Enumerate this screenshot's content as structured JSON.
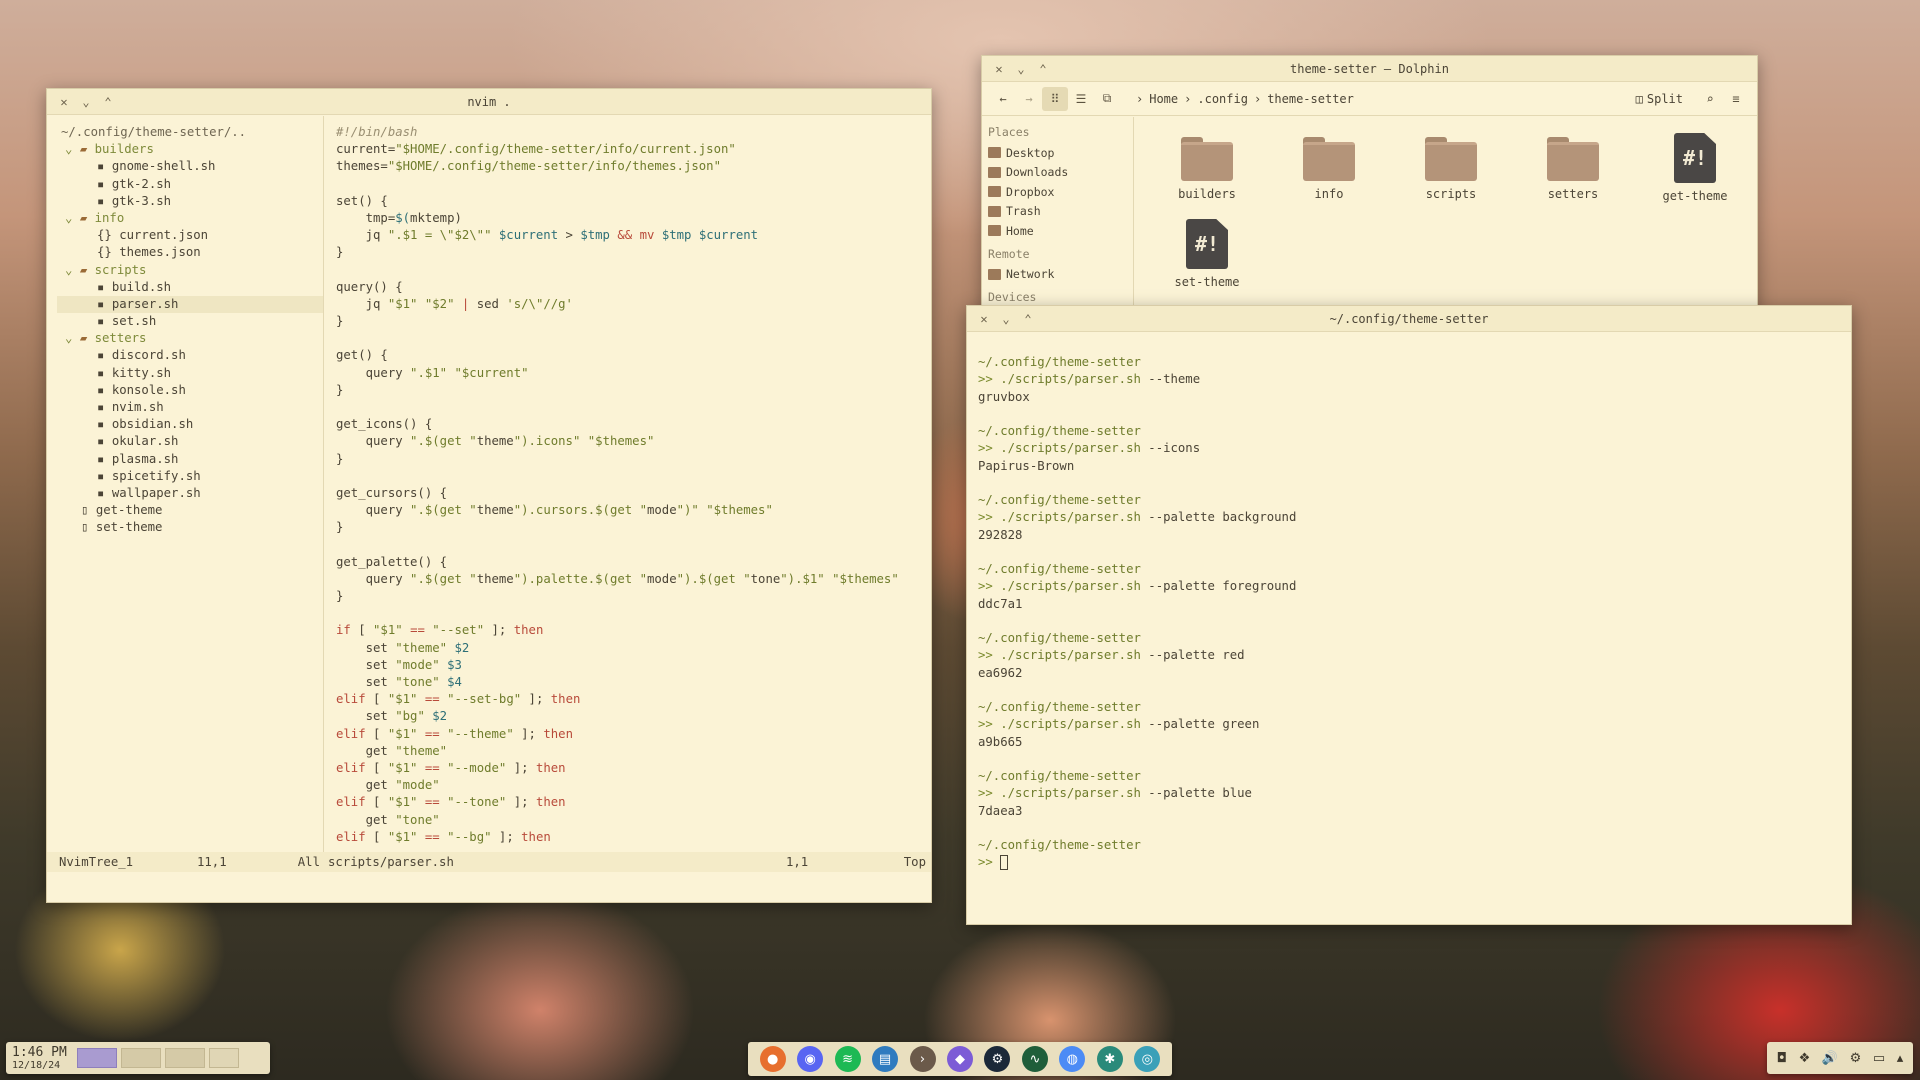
{
  "nvim": {
    "title": "nvim .",
    "tree": [
      {
        "t": "~/.config/theme-setter/..",
        "d": 0,
        "k": "root"
      },
      {
        "t": "builders",
        "d": 1,
        "k": "dir"
      },
      {
        "t": "gnome-shell.sh",
        "d": 2,
        "k": "sh"
      },
      {
        "t": "gtk-2.sh",
        "d": 2,
        "k": "sh"
      },
      {
        "t": "gtk-3.sh",
        "d": 2,
        "k": "sh"
      },
      {
        "t": "info",
        "d": 1,
        "k": "dir"
      },
      {
        "t": "current.json",
        "d": 2,
        "k": "json"
      },
      {
        "t": "themes.json",
        "d": 2,
        "k": "json"
      },
      {
        "t": "scripts",
        "d": 1,
        "k": "dir"
      },
      {
        "t": "build.sh",
        "d": 2,
        "k": "sh"
      },
      {
        "t": "parser.sh",
        "d": 2,
        "k": "sh",
        "sel": true
      },
      {
        "t": "set.sh",
        "d": 2,
        "k": "sh"
      },
      {
        "t": "setters",
        "d": 1,
        "k": "dir"
      },
      {
        "t": "discord.sh",
        "d": 2,
        "k": "sh"
      },
      {
        "t": "kitty.sh",
        "d": 2,
        "k": "sh"
      },
      {
        "t": "konsole.sh",
        "d": 2,
        "k": "sh"
      },
      {
        "t": "nvim.sh",
        "d": 2,
        "k": "sh"
      },
      {
        "t": "obsidian.sh",
        "d": 2,
        "k": "sh"
      },
      {
        "t": "okular.sh",
        "d": 2,
        "k": "sh"
      },
      {
        "t": "plasma.sh",
        "d": 2,
        "k": "sh"
      },
      {
        "t": "spicetify.sh",
        "d": 2,
        "k": "sh"
      },
      {
        "t": "wallpaper.sh",
        "d": 2,
        "k": "sh"
      },
      {
        "t": "get-theme",
        "d": 1,
        "k": "file"
      },
      {
        "t": "set-theme",
        "d": 1,
        "k": "file"
      }
    ],
    "code": [
      "#!/bin/bash",
      "current=\"$HOME/.config/theme-setter/info/current.json\"",
      "themes=\"$HOME/.config/theme-setter/info/themes.json\"",
      "",
      "set() {",
      "    tmp=$(mktemp)",
      "    jq \".$1 = \\\"$2\\\"\" $current > $tmp && mv $tmp $current",
      "}",
      "",
      "query() {",
      "    jq \"$1\" \"$2\" | sed 's/\\\"//g'",
      "}",
      "",
      "get() {",
      "    query \".$1\" \"$current\"",
      "}",
      "",
      "get_icons() {",
      "    query \".$(get \"theme\").icons\" \"$themes\"",
      "}",
      "",
      "get_cursors() {",
      "    query \".$(get \"theme\").cursors.$(get \"mode\")\" \"$themes\"",
      "}",
      "",
      "get_palette() {",
      "    query \".$(get \"theme\").palette.$(get \"mode\").$(get \"tone\").$1\" \"$themes\"",
      "}",
      "",
      "if [ \"$1\" == \"--set\" ]; then",
      "    set \"theme\" $2",
      "    set \"mode\" $3",
      "    set \"tone\" $4",
      "elif [ \"$1\" == \"--set-bg\" ]; then",
      "    set \"bg\" $2",
      "elif [ \"$1\" == \"--theme\" ]; then",
      "    get \"theme\"",
      "elif [ \"$1\" == \"--mode\" ]; then",
      "    get \"mode\"",
      "elif [ \"$1\" == \"--tone\" ]; then",
      "    get \"tone\"",
      "elif [ \"$1\" == \"--bg\" ]; then"
    ],
    "status": {
      "tree_name": "NvimTree_1",
      "tree_pos": "11,1",
      "tree_pct": "All",
      "file": "scripts/parser.sh",
      "pos": "1,1",
      "pct": "Top"
    }
  },
  "dolphin": {
    "title": "theme-setter — Dolphin",
    "breadcrumb": [
      "Home",
      ".config",
      "theme-setter"
    ],
    "split_label": "Split",
    "places_header": "Places",
    "places": [
      "Desktop",
      "Downloads",
      "Dropbox",
      "Trash",
      "Home"
    ],
    "remote_header": "Remote",
    "remote": [
      "Network"
    ],
    "devices_header": "Devices",
    "items": [
      {
        "name": "builders",
        "kind": "folder"
      },
      {
        "name": "info",
        "kind": "folder"
      },
      {
        "name": "scripts",
        "kind": "folder"
      },
      {
        "name": "setters",
        "kind": "folder"
      },
      {
        "name": "get-theme",
        "kind": "script"
      },
      {
        "name": "set-theme",
        "kind": "script"
      }
    ],
    "script_glyph": "#!"
  },
  "terminal": {
    "title": "~/.config/theme-setter",
    "prompt_dir": "~/.config/theme-setter",
    "prompt_symbol": ">>",
    "entries": [
      {
        "cmd": "./scripts/parser.sh",
        "args": "--theme",
        "out": "gruvbox"
      },
      {
        "cmd": "./scripts/parser.sh",
        "args": "--icons",
        "out": "Papirus-Brown"
      },
      {
        "cmd": "./scripts/parser.sh",
        "args": "--palette background",
        "out": "292828"
      },
      {
        "cmd": "./scripts/parser.sh",
        "args": "--palette foreground",
        "out": "ddc7a1"
      },
      {
        "cmd": "./scripts/parser.sh",
        "args": "--palette red",
        "out": "ea6962"
      },
      {
        "cmd": "./scripts/parser.sh",
        "args": "--palette green",
        "out": "a9b665"
      },
      {
        "cmd": "./scripts/parser.sh",
        "args": "--palette blue",
        "out": "7daea3"
      }
    ]
  },
  "taskbar": {
    "time": "1:46 PM",
    "date": "12/18/24",
    "dock": [
      {
        "name": "firefox-icon",
        "color": "#e76f2e",
        "glyph": "●"
      },
      {
        "name": "discord-icon",
        "color": "#5865f2",
        "glyph": "◉"
      },
      {
        "name": "spotify-icon",
        "color": "#1db954",
        "glyph": "≋"
      },
      {
        "name": "file-manager-icon",
        "color": "#2f7bbf",
        "glyph": "▤"
      },
      {
        "name": "terminal-icon",
        "color": "#6b5a4a",
        "glyph": "›"
      },
      {
        "name": "obsidian-icon",
        "color": "#7c5cd6",
        "glyph": "◆"
      },
      {
        "name": "steam-icon",
        "color": "#1b2838",
        "glyph": "⚙"
      },
      {
        "name": "system-monitor-icon",
        "color": "#1f5e3a",
        "glyph": "∿"
      },
      {
        "name": "chrome-icon",
        "color": "#4c8bf5",
        "glyph": "◍"
      },
      {
        "name": "settings-icon",
        "color": "#2a8a7a",
        "glyph": "✱"
      },
      {
        "name": "app-icon",
        "color": "#3aa0b8",
        "glyph": "◎"
      }
    ],
    "tray": [
      "discord-tray-icon",
      "dropbox-tray-icon",
      "volume-icon",
      "settings-tray-icon",
      "display-icon",
      "expand-arrow-icon"
    ],
    "tray_glyphs": [
      "◘",
      "❖",
      "🔊",
      "⚙",
      "▭",
      "▴"
    ]
  }
}
